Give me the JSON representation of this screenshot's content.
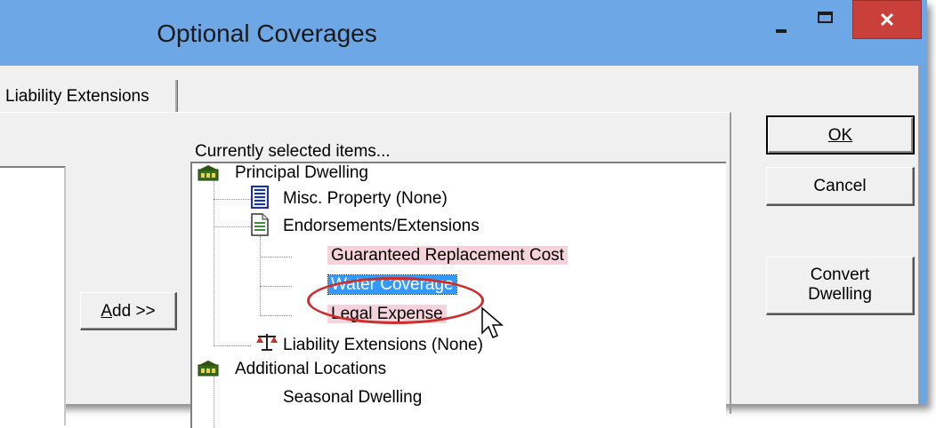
{
  "window": {
    "title": "Optional Coverages",
    "controls": {
      "minimize": "minimize-icon",
      "maximize": "maximize-icon",
      "close": "close-icon"
    }
  },
  "tabs": [
    {
      "label": "Liability Extensions"
    }
  ],
  "buttons": {
    "ok_label": "OK",
    "cancel_label": "Cancel",
    "convert_line1": "Convert",
    "convert_line2": "Dwelling",
    "add_label": "Add >>"
  },
  "selected_items_label": "Currently selected items...",
  "tree": {
    "principal": "Principal Dwelling",
    "misc": "Misc. Property (None)",
    "endorsements": "Endorsements/Extensions",
    "grc": "Guaranteed Replacement Cost",
    "water": "Water Coverage",
    "legal": "Legal Expense",
    "liability": "Liability Extensions (None)",
    "additional": "Additional Locations",
    "seasonal": "Seasonal Dwelling"
  },
  "colors": {
    "titlebar": "#6ea7e6",
    "close": "#c9403a",
    "selection": "#3399ff",
    "pink_highlight": "#f6d2dd",
    "annotation": "#cf2c2c"
  }
}
